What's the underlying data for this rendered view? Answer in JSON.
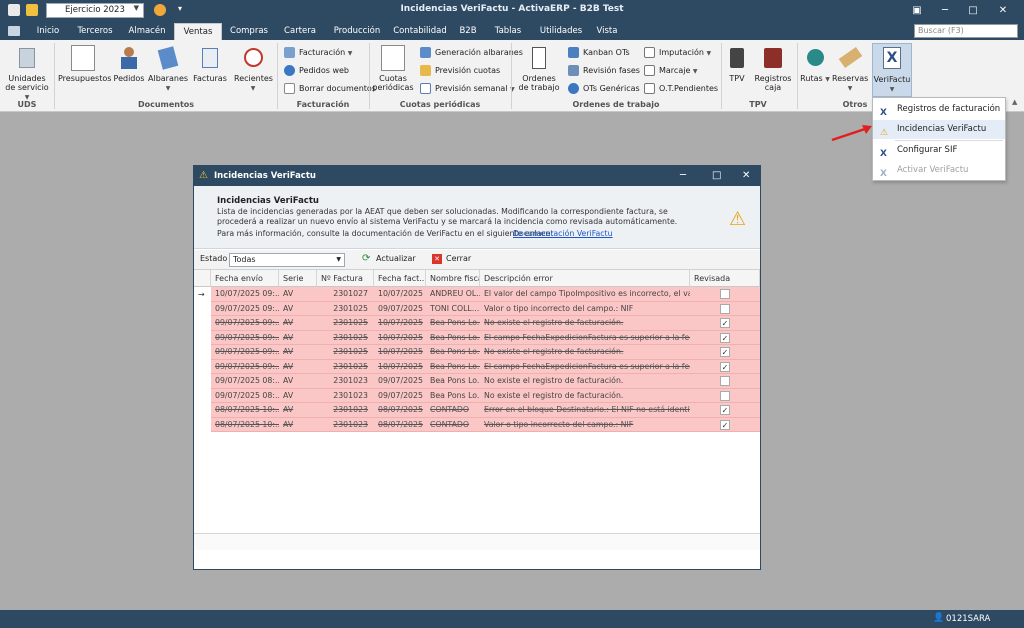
{
  "app": {
    "title": "Incidencias VeriFactu - ActivaERP - B2B Test",
    "year": "Ejercicio 2023",
    "search_placeholder": "Buscar (F3)"
  },
  "menu": [
    "Inicio",
    "Terceros",
    "Almacén",
    "Ventas",
    "Compras",
    "Cartera",
    "Producción",
    "Contabilidad",
    "B2B",
    "Tablas",
    "Utilidades",
    "Vista"
  ],
  "ribbon": {
    "uds": {
      "btn": "Unidades de servicio",
      "group": "UDS"
    },
    "documentos": {
      "presupuestos": "Presupuestos",
      "pedidos": "Pedidos",
      "albaranes": "Albaranes",
      "facturas": "Facturas",
      "recientes": "Recientes",
      "group": "Documentos"
    },
    "facturacion": {
      "facturacion": "Facturación",
      "pedidos_web": "Pedidos web",
      "borrar": "Borrar documentos",
      "group": "Facturación"
    },
    "cuotas": {
      "cuotas": "Cuotas periódicas",
      "generacion": "Generación albaranes",
      "prevision": "Previsión cuotas",
      "semanal": "Previsión semanal",
      "group": "Cuotas periódicas"
    },
    "ordenes": {
      "ordenes": "Ordenes de trabajo",
      "kanban": "Kanban OTs",
      "revision": "Revisión fases",
      "genericas": "OTs Genéricas",
      "imputacion": "Imputación",
      "marcaje": "Marcaje",
      "pendientes": "O.T.Pendientes",
      "group": "Ordenes de trabajo"
    },
    "tpv": {
      "tpv": "TPV",
      "registros_caja": "Registros caja",
      "group": "TPV"
    },
    "otros": {
      "rutas": "Rutas",
      "reservas": "Reservas",
      "verifactu": "VeriFactu",
      "group": "Otros"
    }
  },
  "dropdown": [
    "Registros de facturación",
    "Incidencias VeriFactu",
    "Configurar SIF",
    "Activar VeriFactu"
  ],
  "dialog": {
    "title": "Incidencias VeriFactu",
    "heading": "Incidencias VeriFactu",
    "desc": "Lista de incidencias generadas por la AEAT que deben ser solucionadas. Modificando la correspondiente factura, se procederá a realizar un nuevo envío al sistema VeriFactu y se marcará la incidencia como revisada automáticamente.",
    "more": "Para más información, consulte la documentación de VeriFactu en el siguiente enlace:",
    "link": "Documentación VeriFactu",
    "estado_label": "Estado",
    "estado_value": "Todas",
    "actualizar": "Actualizar",
    "cerrar": "Cerrar",
    "columns": [
      "Fecha envío",
      "Serie",
      "Nº Factura",
      "Fecha fact...",
      "Nombre fiscal",
      "Descripción error",
      "Revisada"
    ],
    "rows": [
      {
        "fecha": "10/07/2025 09:...",
        "serie": "AV",
        "num": "2301027",
        "ffact": "10/07/2025",
        "nombre": "ANDREU OL...",
        "desc": "El valor del campo TipoImpositivo es incorrecto, el valor in...",
        "rev": false
      },
      {
        "fecha": "09/07/2025 09:...",
        "serie": "AV",
        "num": "2301025",
        "ffact": "09/07/2025",
        "nombre": "TONI COLL...",
        "desc": "Valor o tipo incorrecto del campo.: NIF",
        "rev": false
      },
      {
        "fecha": "09/07/2025 09:...",
        "serie": "AV",
        "num": "2301025",
        "ffact": "10/07/2025",
        "nombre": "Bea Pons Lo...",
        "desc": "No existe el registro de facturación.",
        "rev": true
      },
      {
        "fecha": "09/07/2025 09:...",
        "serie": "AV",
        "num": "2301025",
        "ffact": "10/07/2025",
        "nombre": "Bea Pons Lo...",
        "desc": "El campo FechaExpedicionFactura es superior a la fecha...",
        "rev": true
      },
      {
        "fecha": "09/07/2025 09:...",
        "serie": "AV",
        "num": "2301025",
        "ffact": "10/07/2025",
        "nombre": "Bea Pons Lo...",
        "desc": "No existe el registro de facturación.",
        "rev": true
      },
      {
        "fecha": "09/07/2025 09:...",
        "serie": "AV",
        "num": "2301025",
        "ffact": "10/07/2025",
        "nombre": "Bea Pons Lo...",
        "desc": "El campo FechaExpedicionFactura es superior a la fecha...",
        "rev": true
      },
      {
        "fecha": "09/07/2025 08:...",
        "serie": "AV",
        "num": "2301023",
        "ffact": "09/07/2025",
        "nombre": "Bea Pons Lo...",
        "desc": "No existe el registro de facturación.",
        "rev": false
      },
      {
        "fecha": "09/07/2025 08:...",
        "serie": "AV",
        "num": "2301023",
        "ffact": "09/07/2025",
        "nombre": "Bea Pons Lo...",
        "desc": "No existe el registro de facturación.",
        "rev": false
      },
      {
        "fecha": "08/07/2025 10:...",
        "serie": "AV",
        "num": "2301023",
        "ffact": "08/07/2025",
        "nombre": "CONTADO",
        "desc": "Error en el bloque Destinatario.: El NIF no está identificad...",
        "rev": true
      },
      {
        "fecha": "08/07/2025 10:...",
        "serie": "AV",
        "num": "2301023",
        "ffact": "08/07/2025",
        "nombre": "CONTADO",
        "desc": "Valor o tipo incorrecto del campo.: NIF",
        "rev": true
      }
    ]
  },
  "status": {
    "user": "0121SARA"
  },
  "colors": {
    "titlebar": "#2e4a63",
    "row_error": "#fbc6c6",
    "link": "#1a55cc",
    "arrow": "#e0201e"
  }
}
